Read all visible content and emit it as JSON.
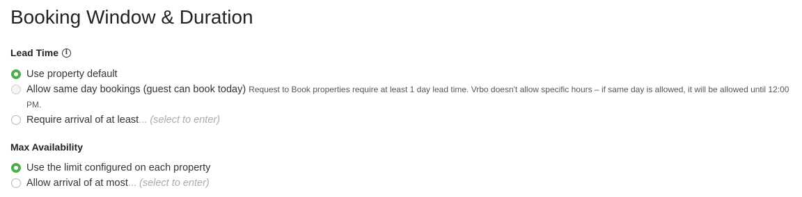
{
  "page": {
    "title": "Booking Window & Duration"
  },
  "lead_time": {
    "heading": "Lead Time",
    "info_icon": "info-circle-icon",
    "options": [
      {
        "label": "Use property default",
        "checked": true
      },
      {
        "label": "Allow same day bookings (guest can book today)",
        "note": "Request to Book properties require at least 1 day lead time. Vrbo doesn't allow specific hours – if same day is allowed, it will be allowed until 12:00 PM.",
        "disabled": true
      },
      {
        "label": "Require arrival of at least",
        "ellipsis": "...",
        "hint": "(select to enter)"
      }
    ]
  },
  "max_availability": {
    "heading": "Max Availability",
    "options": [
      {
        "label": "Use the limit configured on each property",
        "checked": true
      },
      {
        "label": "Allow arrival of at most",
        "ellipsis": "...",
        "hint": "(select to enter)"
      }
    ]
  },
  "colors": {
    "accent": "#4cae4c",
    "hint": "#aaaaaa"
  }
}
